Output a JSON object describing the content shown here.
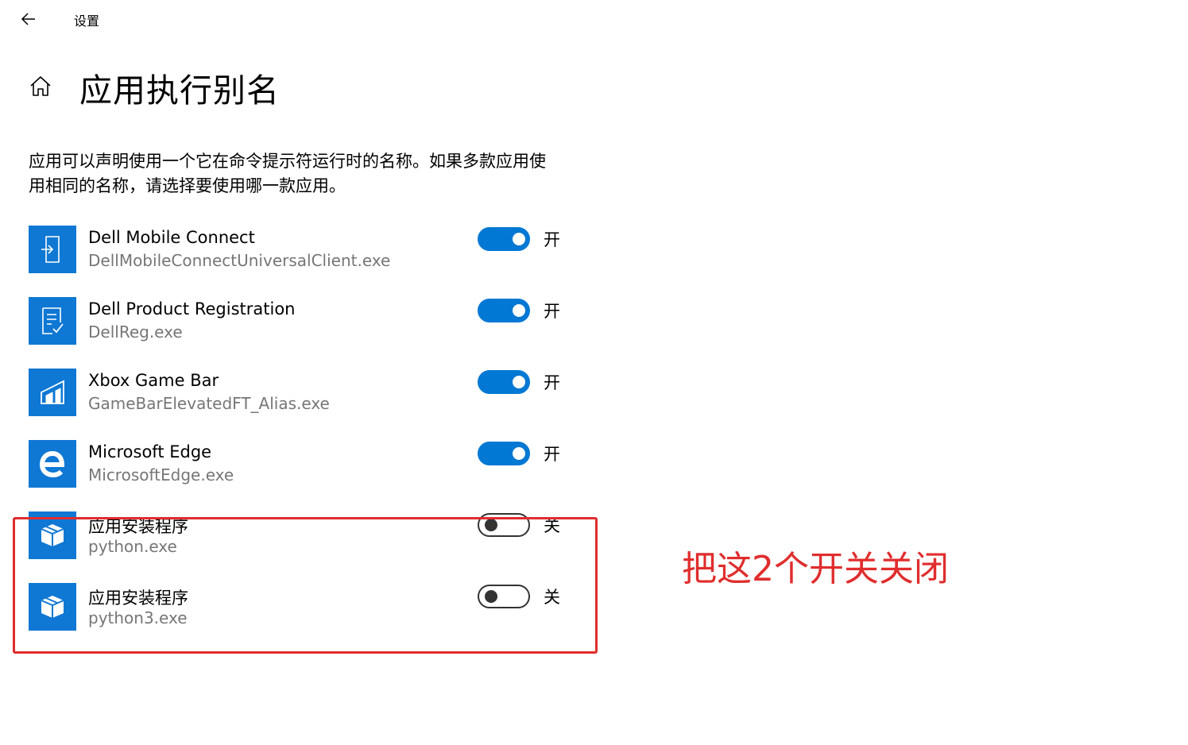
{
  "window": {
    "title": "设置"
  },
  "page": {
    "title": "应用执行别名",
    "description": "应用可以声明使用一个它在命令提示符运行时的名称。如果多款应用使用相同的名称，请选择要使用哪一款应用。"
  },
  "apps": [
    {
      "name": "Dell Mobile Connect",
      "exe": "DellMobileConnectUniversalClient.exe",
      "state": "开",
      "on": true,
      "icon": "dell-mobile-connect-icon"
    },
    {
      "name": "Dell Product Registration",
      "exe": "DellReg.exe",
      "state": "开",
      "on": true,
      "icon": "dell-registration-icon"
    },
    {
      "name": "Xbox Game Bar",
      "exe": "GameBarElevatedFT_Alias.exe",
      "state": "开",
      "on": true,
      "icon": "xbox-game-bar-icon"
    },
    {
      "name": "Microsoft Edge",
      "exe": "MicrosoftEdge.exe",
      "state": "开",
      "on": true,
      "icon": "edge-icon"
    },
    {
      "name": "应用安装程序",
      "exe": "python.exe",
      "state": "关",
      "on": false,
      "icon": "app-installer-icon"
    },
    {
      "name": "应用安装程序",
      "exe": "python3.exe",
      "state": "关",
      "on": false,
      "icon": "app-installer-icon"
    }
  ],
  "annotation": {
    "text": "把这2个开关关闭"
  },
  "colors": {
    "accent": "#0078d4",
    "tile": "#0f78d4",
    "annotation": "#e02d2d",
    "secondary_text": "#767676"
  }
}
